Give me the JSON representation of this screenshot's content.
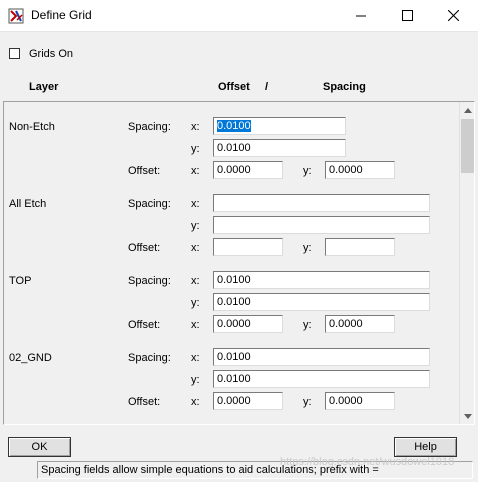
{
  "window": {
    "title": "Define Grid"
  },
  "grids_on": {
    "label": "Grids On",
    "checked": false
  },
  "headers": {
    "layer": "Layer",
    "offset": "Offset",
    "slash": "/",
    "spacing": "Spacing"
  },
  "labels": {
    "spacing": "Spacing:",
    "offset": "Offset:",
    "x": "x:",
    "y": "y:"
  },
  "layers": [
    {
      "name": "Non-Etch",
      "spacing_x": "0.0100",
      "spacing_y": "0.0100",
      "offset_x": "0.0000",
      "offset_y": "0.0000"
    },
    {
      "name": "All Etch",
      "spacing_x": "",
      "spacing_y": "",
      "offset_x": "",
      "offset_y": ""
    },
    {
      "name": "TOP",
      "spacing_x": "0.0100",
      "spacing_y": "0.0100",
      "offset_x": "0.0000",
      "offset_y": "0.0000"
    },
    {
      "name": "02_GND",
      "spacing_x": "0.0100",
      "spacing_y": "0.0100",
      "offset_x": "0.0000",
      "offset_y": "0.0000"
    }
  ],
  "buttons": {
    "ok": "OK",
    "help": "Help"
  },
  "status_text": "Spacing fields allow simple equations to aid calculations; prefix with =",
  "watermark": "https://blog.csdn.net/wusdowel1018",
  "scroll_position": 0
}
